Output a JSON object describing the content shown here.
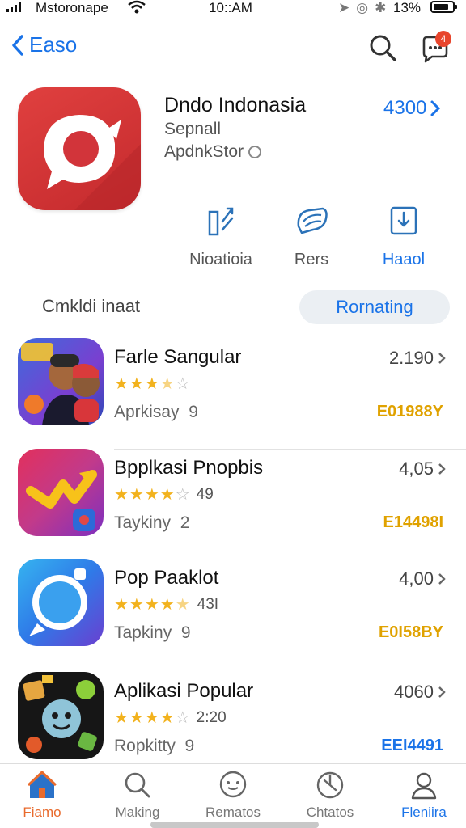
{
  "status_bar": {
    "carrier": "Mstoronape",
    "time": "10::AM",
    "battery_pct": "13%"
  },
  "nav": {
    "back_label": "Easo",
    "notification_badge": "4"
  },
  "app": {
    "title": "Dndo Indonasia",
    "subtitle1": "Sepnall",
    "subtitle2": "ApdnkStor",
    "count": "4300",
    "icon_color": "#d8363a"
  },
  "actions": [
    {
      "label": "Nioatioia",
      "icon": "share-icon"
    },
    {
      "label": "Rers",
      "icon": "chat-icon"
    },
    {
      "label": "Haaol",
      "icon": "download-icon"
    }
  ],
  "section": {
    "label": "Cmkldi inaat",
    "pill": "Rornating"
  },
  "list": [
    {
      "name": "Farle Sangular",
      "stars_filled": 3.5,
      "rating_count": "",
      "category": "Aprkisay",
      "rank": "9",
      "count": "2.190",
      "tag": "E01988Y"
    },
    {
      "name": "Bpplkasi Pnopbis",
      "stars_filled": 4,
      "rating_count": "49",
      "category": "Taykiny",
      "rank": "2",
      "count": "4,05",
      "tag": "E14498I"
    },
    {
      "name": "Pop Paaklot",
      "stars_filled": 4.5,
      "rating_count": "43I",
      "category": "Tapkiny",
      "rank": "9",
      "count": "4,00",
      "tag": "E0I58BY"
    },
    {
      "name": "Aplikasi Popular",
      "stars_filled": 4,
      "rating_count": "2:20",
      "category": "Ropkitty",
      "rank": "9",
      "count": "4060",
      "tag": "EEI4491"
    }
  ],
  "tabbar": [
    {
      "label": "Fiamo",
      "icon": "home-icon"
    },
    {
      "label": "Making",
      "icon": "search-icon"
    },
    {
      "label": "Rematos",
      "icon": "chat-icon"
    },
    {
      "label": "Chtatos",
      "icon": "clock-icon"
    },
    {
      "label": "Fleniira",
      "icon": "person-icon"
    }
  ],
  "colors": {
    "accent": "#1a73e8",
    "star": "#f2b21d",
    "tag": "#e0a200",
    "active_tab": "#e86a2c"
  }
}
